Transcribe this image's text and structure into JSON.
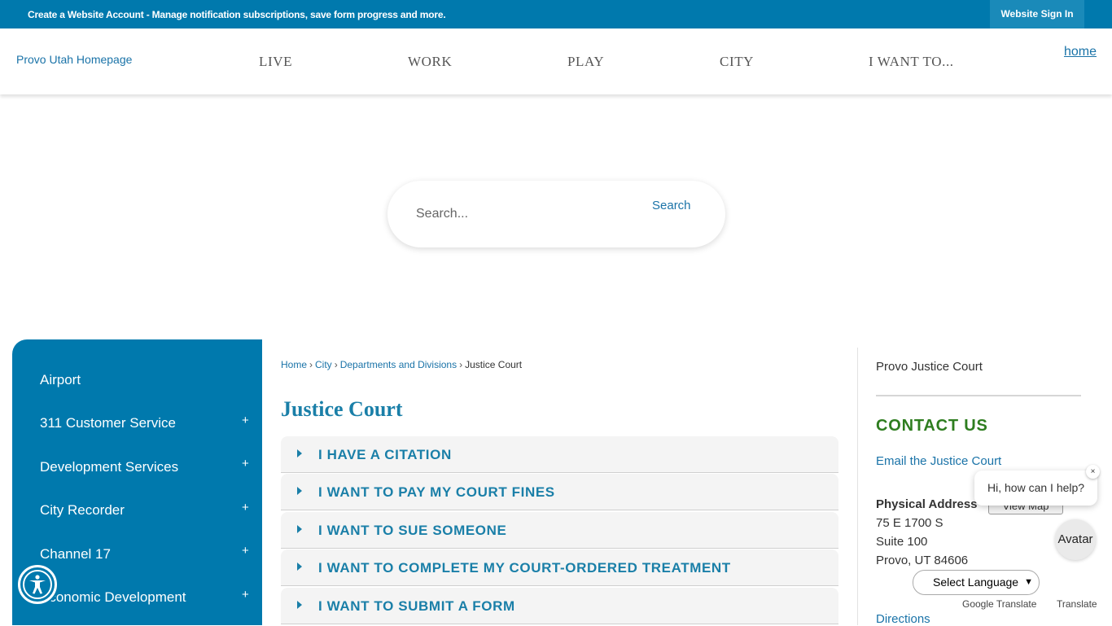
{
  "topbar": {
    "message": "Create a Website Account - Manage notification subscriptions, save form progress and more.",
    "signin": "Website Sign In"
  },
  "header": {
    "logo_alt": "Provo Utah Homepage",
    "nav": [
      "LIVE",
      "WORK",
      "PLAY",
      "CITY",
      "I WANT TO..."
    ],
    "home_alt": "home"
  },
  "search": {
    "placeholder": "Search...",
    "button_alt": "Search"
  },
  "sidebar": {
    "items": [
      {
        "label": "Airport",
        "expandable": false
      },
      {
        "label": "311 Customer Service",
        "expandable": true
      },
      {
        "label": "Development Services",
        "expandable": true
      },
      {
        "label": "City Recorder",
        "expandable": true
      },
      {
        "label": "Channel 17",
        "expandable": true
      },
      {
        "label": "Economic Development",
        "expandable": true
      }
    ],
    "plus": "+"
  },
  "breadcrumb": {
    "links": [
      "Home",
      "City",
      "Departments and Divisions"
    ],
    "current": "Justice Court",
    "separator": "›"
  },
  "main": {
    "title": "Justice Court",
    "accordion": [
      "I HAVE A CITATION",
      "I WANT TO PAY MY COURT FINES",
      "I WANT TO SUE SOMEONE",
      "I WANT TO COMPLETE MY COURT-ORDERED TREATMENT",
      "I WANT TO SUBMIT A FORM"
    ]
  },
  "contact": {
    "image_alt": "Provo Justice Court",
    "title": "CONTACT US",
    "email_link": "Email the Justice Court",
    "address_label": "Physical Address",
    "view_map": "View Map",
    "address_lines": [
      "75 E 1700 S",
      "Suite 100",
      "Provo, UT 84606"
    ],
    "directions": "Directions"
  },
  "widgets": {
    "chat_text": "Hi, how can I help?",
    "chat_close": "×",
    "avatar_label": "Avatar",
    "language_select": "Select Language",
    "google_translate_alt": "Google Translate",
    "translate_word": "Translate"
  },
  "colors": {
    "brand_blue": "#0079ad",
    "link_blue": "#1a73a8",
    "contact_green": "#2e7d1f"
  }
}
